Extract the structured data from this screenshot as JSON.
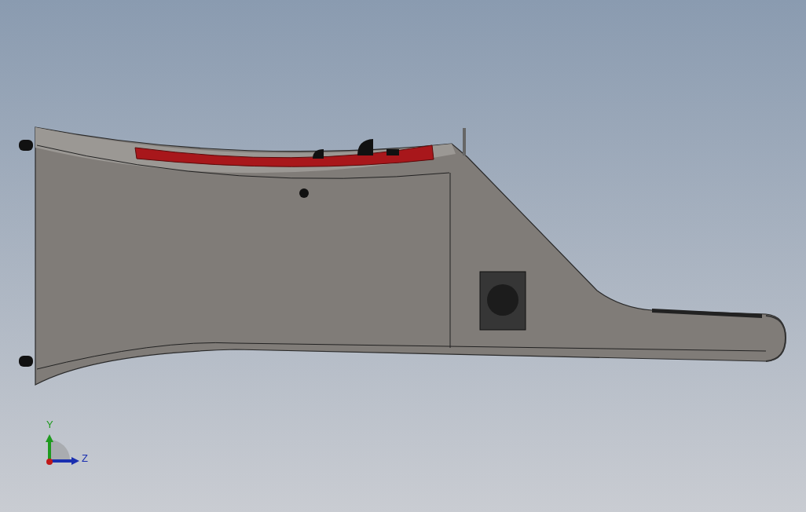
{
  "triad": {
    "axes": [
      {
        "kind": "vertical",
        "label": "Y"
      },
      {
        "kind": "horizontal",
        "label": "Z"
      }
    ]
  }
}
